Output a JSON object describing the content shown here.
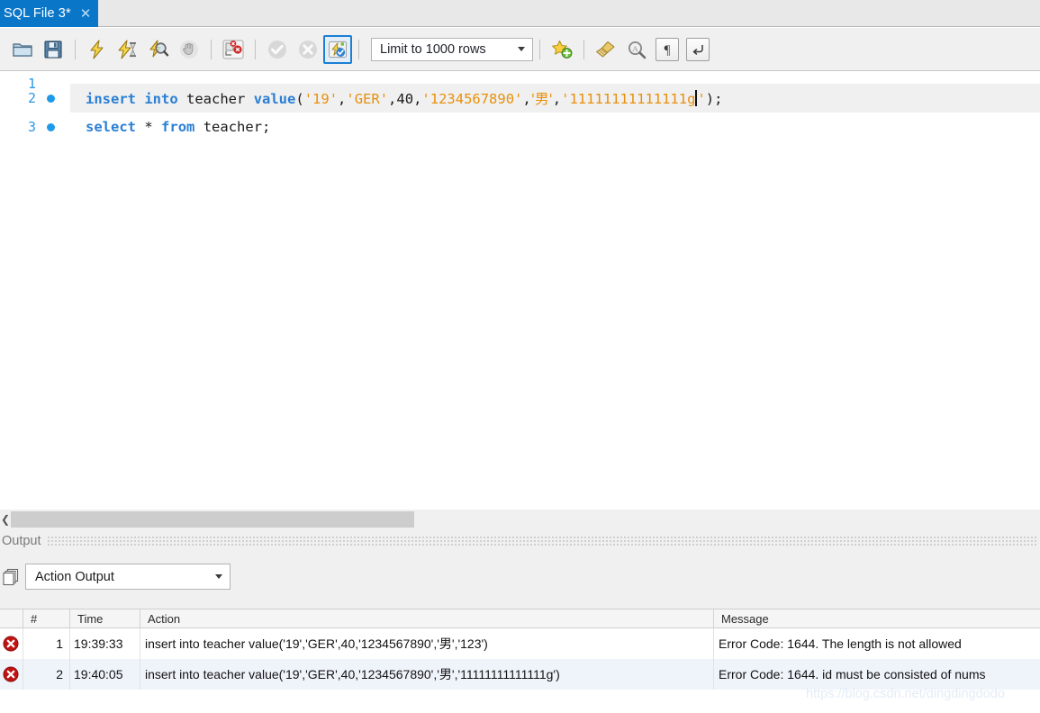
{
  "tab": {
    "label": "SQL File 3*",
    "close_icon": "close-icon"
  },
  "toolbar": {
    "icons": [
      {
        "name": "open-file-icon",
        "title": "Open SQL Script File"
      },
      {
        "name": "save-file-icon",
        "title": "Save SQL Script"
      },
      {
        "name": "execute-icon",
        "title": "Execute Statement"
      },
      {
        "name": "execute-current-icon",
        "title": "Execute Current Statement"
      },
      {
        "name": "explain-icon",
        "title": "Explain Current Statement"
      },
      {
        "name": "stop-icon",
        "title": "Stop Statement"
      },
      {
        "name": "toggle-stop-on-error-icon",
        "title": "Toggle whether execution should stop on error"
      },
      {
        "name": "commit-icon",
        "title": "Commit"
      },
      {
        "name": "rollback-icon",
        "title": "Rollback"
      },
      {
        "name": "autocommit-icon",
        "title": "Toggle Autocommit Mode"
      }
    ],
    "limit_label": "Limit to 1000 rows",
    "limit_caret": "chevron-down-icon",
    "right_icons": [
      {
        "name": "add-snippet-icon",
        "title": "Save snippet"
      },
      {
        "name": "beautify-icon",
        "title": "Beautify SQL"
      },
      {
        "name": "find-icon",
        "title": "Find"
      },
      {
        "name": "invisible-chars-icon",
        "title": "Toggle invisible characters"
      },
      {
        "name": "wrap-lines-icon",
        "title": "Toggle wrapping of long lines"
      }
    ]
  },
  "editor": {
    "lines": [
      {
        "num": "1",
        "marker": false
      },
      {
        "num": "2",
        "marker": true
      },
      {
        "num": "3",
        "marker": true
      }
    ],
    "line2": {
      "kw_insert": "insert",
      "kw_into": "into",
      "table": "teacher",
      "kw_value": "value",
      "open": "(",
      "s_id": "'19'",
      "c1": ",",
      "s_name": "'GER'",
      "c2": ",",
      "n_age": "40",
      "c3": ",",
      "s_phone": "'1234567890'",
      "c4": ",",
      "s_gender": "'男'",
      "c5": ",",
      "s_last_open": "'",
      "s_last_body": "11111111111111g",
      "s_last_close": "'",
      "close": ");"
    },
    "line3": {
      "kw_select": "select",
      "star": "*",
      "kw_from": "from",
      "table": "teacher",
      "semi": ";"
    }
  },
  "scrollbar": {
    "left_arrow": "chevron-left-icon"
  },
  "output": {
    "title": "Output",
    "selector_icon": "panels-icon",
    "selector_value": "Action Output",
    "selector_caret": "chevron-down-icon",
    "columns": [
      "#",
      "Time",
      "Action",
      "Message"
    ],
    "rows": [
      {
        "status": "error-icon",
        "num": "1",
        "time": "19:39:33",
        "action": "insert into teacher value('19','GER',40,'1234567890','男','123')",
        "message": "Error Code: 1644. The length is not allowed"
      },
      {
        "status": "error-icon",
        "num": "2",
        "time": "19:40:05",
        "action": "insert into teacher value('19','GER',40,'1234567890','男','11111111111111g')",
        "message": "Error Code: 1644. id must be consisted of nums"
      }
    ]
  },
  "watermark": "https://blog.csdn.net/dingdingdodo"
}
